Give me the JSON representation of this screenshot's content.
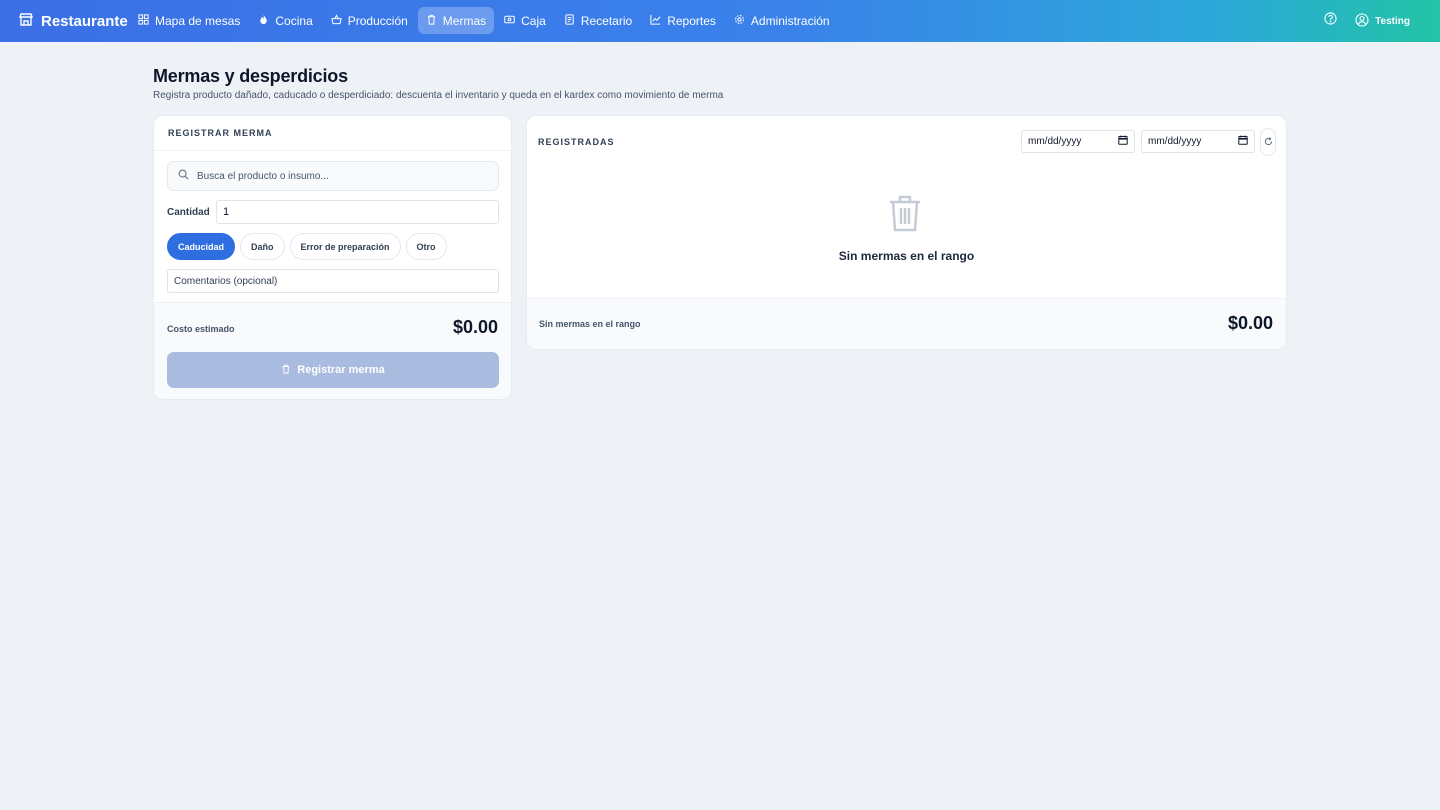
{
  "app": {
    "brand": "Restaurante"
  },
  "nav": {
    "items": [
      {
        "label": "Mapa de mesas",
        "icon": "grid-icon"
      },
      {
        "label": "Cocina",
        "icon": "flame-icon"
      },
      {
        "label": "Producción",
        "icon": "basket-icon"
      },
      {
        "label": "Mermas",
        "icon": "trash-icon",
        "active": true
      },
      {
        "label": "Caja",
        "icon": "cash-icon"
      },
      {
        "label": "Recetario",
        "icon": "book-icon"
      },
      {
        "label": "Reportes",
        "icon": "chart-icon"
      },
      {
        "label": "Administración",
        "icon": "gear-icon"
      }
    ],
    "user": "Testing"
  },
  "page": {
    "title": "Mermas y desperdicios",
    "subtitle": "Registra producto dañado, caducado o desperdiciado: descuenta el inventario y queda en el kardex como movimiento de merma"
  },
  "form": {
    "header": "REGISTRAR MERMA",
    "search_placeholder": "Busca el producto o insumo...",
    "quantity_label": "Cantidad",
    "quantity_value": "1",
    "reasons": [
      "Caducidad",
      "Daño",
      "Error de preparación",
      "Otro"
    ],
    "selected_reason": "Caducidad",
    "comments_placeholder": "Comentarios (opcional)",
    "cost_label": "Costo estimado",
    "cost_value": "$0.00",
    "submit_label": "Registrar merma"
  },
  "registered": {
    "header": "REGISTRADAS",
    "date_placeholder": "mm/dd/yyyy",
    "empty_message": "Sin mermas en el rango",
    "footer_label": "Sin mermas en el rango",
    "footer_total": "$0.00"
  },
  "colors": {
    "accent": "#2f6ee0",
    "nav_gradient_start": "#3b6fe6",
    "nav_gradient_end": "#22c4a6",
    "disabled_button": "#a9bbdf",
    "background": "#eef2f7"
  }
}
